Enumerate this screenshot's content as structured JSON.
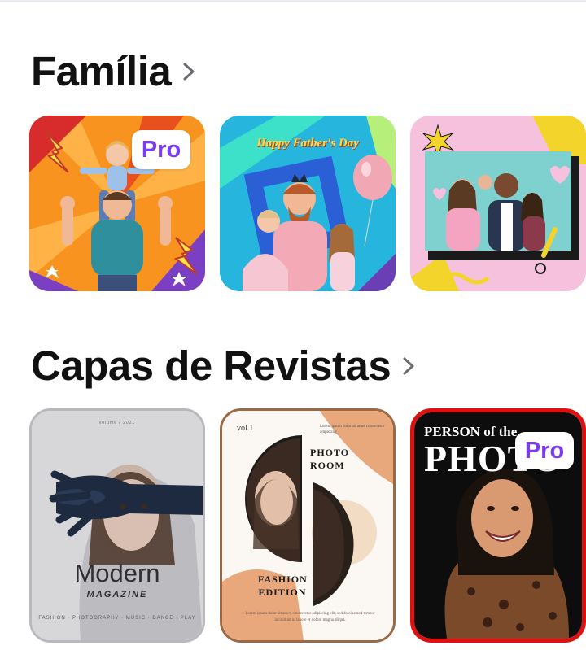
{
  "sections": [
    {
      "title": "Família",
      "tiles": [
        {
          "badge": "Pro"
        },
        {
          "headline": "Happy Father's Day"
        },
        {}
      ]
    },
    {
      "title": "Capas de Revistas",
      "tiles": [
        {
          "top": "volume / 2021",
          "headline": "Modern",
          "subline": "MAGAZINE",
          "footer": "FASHION · PHOTOGRAPHY · MUSIC · DANCE · PLAY"
        },
        {
          "vol": "vol.1",
          "side": "Lorem ipsum dolor sit amet consectetur adipiscing",
          "headline": "PHOTO ROOM",
          "headline2": "FASHION EDITION",
          "footer": "Lorem ipsum dolor sit amet, consectetur adipiscing elit, sed do eiusmod tempor incididunt ut labore et dolore magna aliqua."
        },
        {
          "kicker": "PERSON of the",
          "headline": "PHOTO",
          "badge": "Pro"
        }
      ]
    }
  ],
  "colors": {
    "pro_text": "#7a3cf0",
    "title_text": "#111111"
  },
  "icons": {
    "section_chevron": "chevron-right-icon"
  }
}
